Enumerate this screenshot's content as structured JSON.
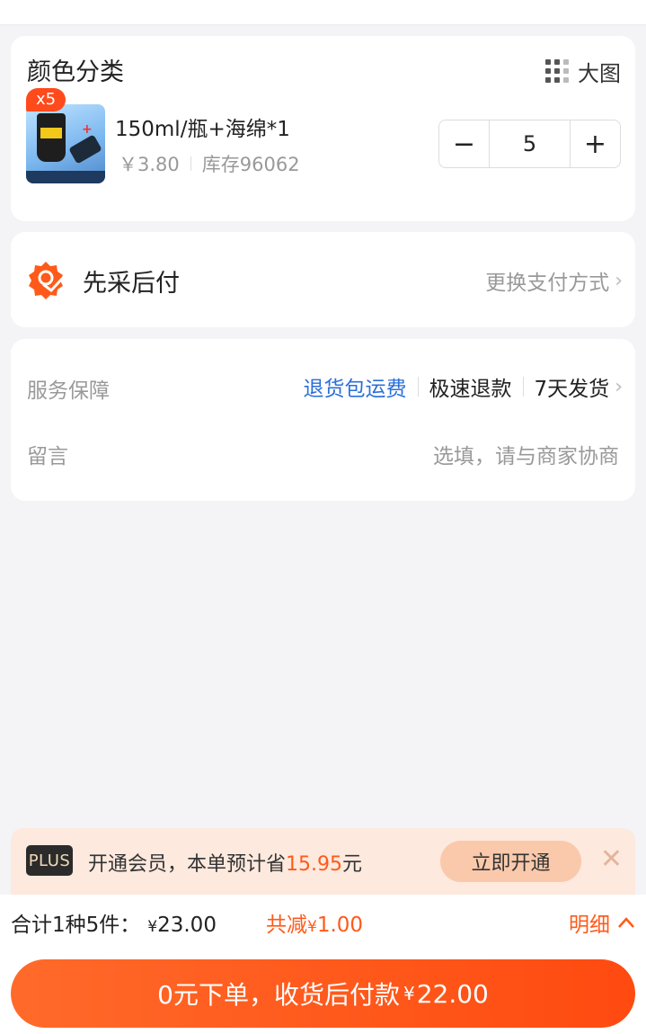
{
  "sku": {
    "section_title": "颜色分类",
    "big_image_label": "大图",
    "quantity_badge": "x5",
    "item_name": "150ml/瓶+海绵*1",
    "price": "￥3.80",
    "stock": "库存96062",
    "quantity": "5",
    "minus_symbol": "−",
    "plus_symbol": "+"
  },
  "payment": {
    "label": "先采后付",
    "change_label": "更换支付方式"
  },
  "service": {
    "label": "服务保障",
    "tags": [
      "退货包运费",
      "极速退款",
      "7天发货"
    ],
    "message_label": "留言",
    "message_placeholder": "选填，请与商家协商"
  },
  "membership": {
    "logo": "PLUS",
    "text_prefix": "开通会员，本单预计省",
    "saving": "15.95",
    "text_suffix": "元",
    "button": "立即开通",
    "close_symbol": "✕"
  },
  "summary": {
    "count_label": "合计1种5件：",
    "total_currency": "¥",
    "total_amount": "23.00",
    "discount_label": "共减",
    "discount_currency": "¥",
    "discount_amount": "1.00",
    "detail_label": "明细"
  },
  "submit": {
    "label": "0元下单，收货后付款",
    "currency": "¥",
    "amount": "22.00"
  },
  "colors": {
    "accent": "#ff5a1a",
    "link_blue": "#2a6fd8",
    "member_bg": "#fde9de"
  }
}
